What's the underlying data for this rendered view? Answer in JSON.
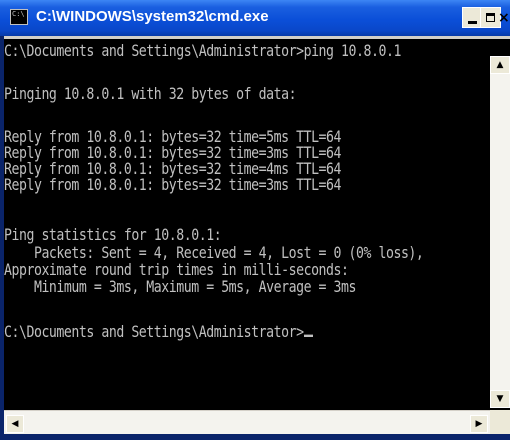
{
  "window": {
    "title": "C:\\WINDOWS\\system32\\cmd.exe",
    "icon_label": "C:\\",
    "controls": {
      "minimize": "minimize-icon",
      "maximize": "maximize-icon",
      "close": "×"
    }
  },
  "console": {
    "lines": [
      "C:\\Documents and Settings\\Administrator>ping 10.8.0.1",
      "",
      "Pinging 10.8.0.1 with 32 bytes of data:",
      "",
      "Reply from 10.8.0.1: bytes=32 time=5ms TTL=64",
      "Reply from 10.8.0.1: bytes=32 time=3ms TTL=64",
      "Reply from 10.8.0.1: bytes=32 time=4ms TTL=64",
      "Reply from 10.8.0.1: bytes=32 time=3ms TTL=64",
      "",
      "Ping statistics for 10.8.0.1:",
      "    Packets: Sent = 4, Received = 4, Lost = 0 (0% loss),",
      "Approximate round trip times in milli-seconds:",
      "    Minimum = 3ms, Maximum = 5ms, Average = 3ms",
      "",
      "C:\\Documents and Settings\\Administrator>"
    ],
    "text_color": "#c0c0c0",
    "background": "#000000"
  },
  "scrollbars": {
    "up_arrow": "▲",
    "down_arrow": "▼",
    "left_arrow": "◀",
    "right_arrow": "▶"
  }
}
